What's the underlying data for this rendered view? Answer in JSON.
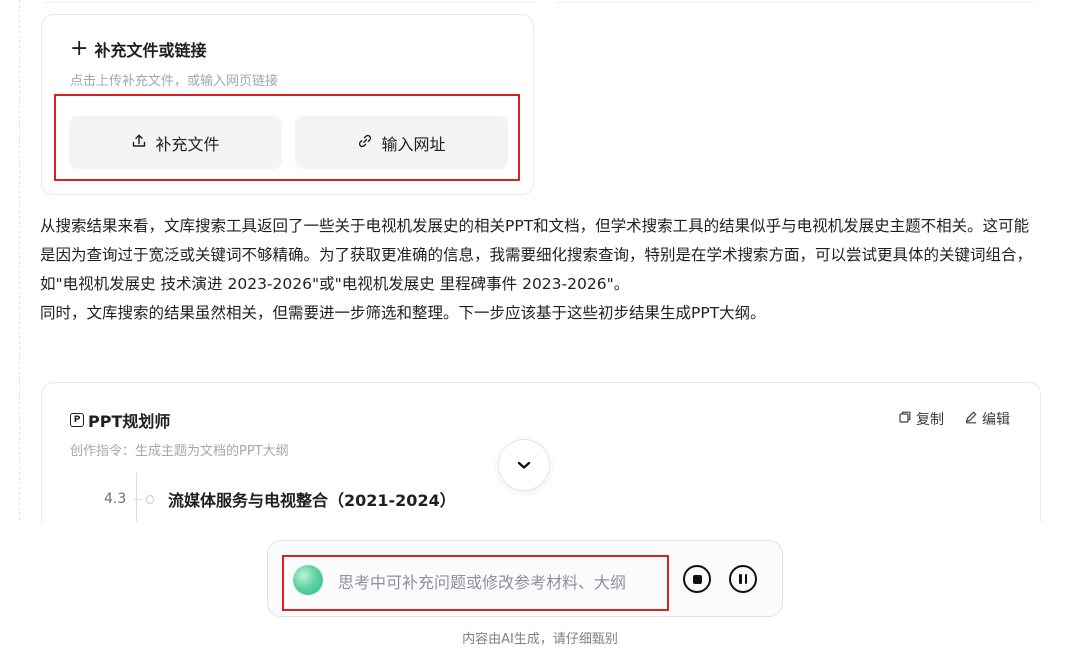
{
  "upload_card": {
    "title": "补充文件或链接",
    "subtitle": "点击上传补充文件，或输入网页链接",
    "buttons": {
      "file_label": "补充文件",
      "url_label": "输入网址"
    },
    "icons": [
      "plus-icon",
      "upload-icon",
      "link-icon"
    ]
  },
  "message": {
    "paragraph_1": "从搜索结果来看，文库搜索工具返回了一些关于电视机发展史的相关PPT和文档，但学术搜索工具的结果似乎与电视机发展史主题不相关。这可能是因为查询过于宽泛或关键词不够精确。为了获取更准确的信息，我需要细化搜索查询，特别是在学术搜索方面，可以尝试更具体的关键词组合，如\"电视机发展史 技术演进 2023-2026\"或\"电视机发展史 里程碑事件 2023-2026\"。",
    "paragraph_2": "同时，文库搜索的结果虽然相关，但需要进一步筛选和整理。下一步应该基于这些初步结果生成PPT大纲。"
  },
  "planner": {
    "icon_text": "P",
    "title": "PPT规划师",
    "subtitle": "创作指令：生成主题为文档的PPT大纲",
    "actions": {
      "copy": "复制",
      "edit": "编辑"
    },
    "outline": [
      {
        "num": "4.3",
        "text": "流媒体服务与电视整合（2021-2024）"
      }
    ]
  },
  "input_bar": {
    "placeholder": "思考中可补充问题或修改参考材料、大纲"
  },
  "footer": {
    "disclaimer": "内容由AI生成，请仔细甄别"
  },
  "colors": {
    "highlight_box": "#e02020",
    "button_bg": "#f3f4f6",
    "muted_text": "#a3a7ae",
    "orb": "#5fd3a3"
  }
}
